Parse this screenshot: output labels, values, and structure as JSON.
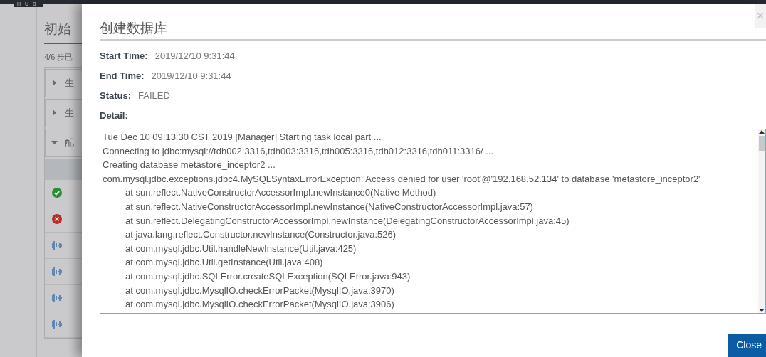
{
  "topbar": {
    "logo": "HUB"
  },
  "background": {
    "title": "初始",
    "progress": "4/6 步已",
    "groups": [
      {
        "label": "生",
        "expanded": false
      },
      {
        "label": "生",
        "expanded": false
      },
      {
        "label": "配",
        "expanded": true
      }
    ],
    "tasks": [
      {
        "kind": "success"
      },
      {
        "kind": "failed"
      },
      {
        "kind": "waiting"
      },
      {
        "kind": "waiting"
      },
      {
        "kind": "waiting"
      },
      {
        "kind": "waiting"
      }
    ]
  },
  "modal": {
    "close_icon": "×",
    "title": "创建数据库",
    "fields": [
      {
        "label": "Start Time:",
        "value": "2019/12/10 9:31:44"
      },
      {
        "label": "End Time:",
        "value": "2019/12/10 9:31:44"
      },
      {
        "label": "Status:",
        "value": "FAILED"
      }
    ],
    "detail_label": "Detail:",
    "log": [
      {
        "kind": "message",
        "text": "Tue Dec 10 09:13:30 CST 2019 [Manager] Starting task local part ..."
      },
      {
        "kind": "message",
        "text": "Connecting to jdbc:mysql://tdh002:3316,tdh003:3316,tdh005:3316,tdh012:3316,tdh011:3316/ ..."
      },
      {
        "kind": "message",
        "text": "Creating database metastore_inceptor2 ..."
      },
      {
        "kind": "message",
        "text": "com.mysql.jdbc.exceptions.jdbc4.MySQLSyntaxErrorException: Access denied for user 'root'@'192.168.52.134' to database 'metastore_inceptor2'"
      },
      {
        "kind": "trace",
        "text": "at sun.reflect.NativeConstructorAccessorImpl.newInstance0(Native Method)"
      },
      {
        "kind": "trace",
        "text": "at sun.reflect.NativeConstructorAccessorImpl.newInstance(NativeConstructorAccessorImpl.java:57)"
      },
      {
        "kind": "trace",
        "text": "at sun.reflect.DelegatingConstructorAccessorImpl.newInstance(DelegatingConstructorAccessorImpl.java:45)"
      },
      {
        "kind": "trace",
        "text": "at java.lang.reflect.Constructor.newInstance(Constructor.java:526)"
      },
      {
        "kind": "trace",
        "text": "at com.mysql.jdbc.Util.handleNewInstance(Util.java:425)"
      },
      {
        "kind": "trace",
        "text": "at com.mysql.jdbc.Util.getInstance(Util.java:408)"
      },
      {
        "kind": "trace",
        "text": "at com.mysql.jdbc.SQLError.createSQLException(SQLError.java:943)"
      },
      {
        "kind": "trace",
        "text": "at com.mysql.jdbc.MysqlIO.checkErrorPacket(MysqlIO.java:3970)"
      },
      {
        "kind": "trace",
        "text": "at com.mysql.jdbc.MysqlIO.checkErrorPacket(MysqlIO.java:3906)"
      }
    ],
    "close_button": "Close"
  }
}
